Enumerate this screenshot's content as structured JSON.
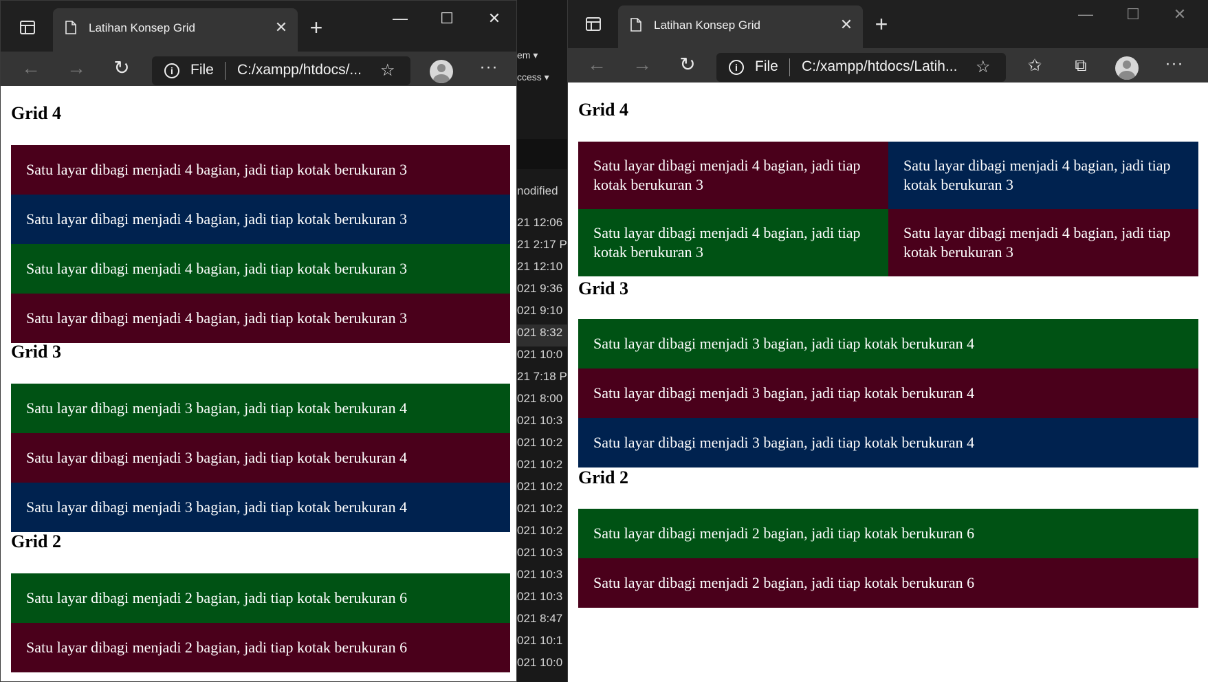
{
  "window_title": "Latihan Konsep Grid",
  "address": {
    "file_label": "File",
    "url_left": "C:/xampp/htdocs/...",
    "url_right": "C:/xampp/htdocs/Latih..."
  },
  "window_controls": {
    "minimize": "—",
    "maximize": "☐",
    "close": "✕"
  },
  "icons": {
    "back": "back-arrow-icon",
    "forward": "forward-arrow-icon",
    "refresh": "refresh-icon",
    "info": "info-icon",
    "favorite_add": "add-favorite-icon",
    "favorites": "favorites-icon",
    "collections": "collections-icon",
    "profile": "profile-avatar-icon",
    "menu": "more-icon"
  },
  "colors": {
    "maroon": "#4a001b",
    "navy": "#00224f",
    "green": "#005214"
  },
  "page": {
    "sections": [
      {
        "title": "Grid 4",
        "items": [
          {
            "text": "Satu layar dibagi menjadi 4 bagian, jadi tiap kotak berukuran 3",
            "color": "maroon"
          },
          {
            "text": "Satu layar dibagi menjadi 4 bagian, jadi tiap kotak berukuran 3",
            "color": "navy"
          },
          {
            "text": "Satu layar dibagi menjadi 4 bagian, jadi tiap kotak berukuran 3",
            "color": "green"
          },
          {
            "text": "Satu layar dibagi menjadi 4 bagian, jadi tiap kotak berukuran 3",
            "color": "maroon"
          }
        ]
      },
      {
        "title": "Grid 3",
        "items": [
          {
            "text": "Satu layar dibagi menjadi 3 bagian, jadi tiap kotak berukuran 4",
            "color": "green"
          },
          {
            "text": "Satu layar dibagi menjadi 3 bagian, jadi tiap kotak berukuran 4",
            "color": "maroon"
          },
          {
            "text": "Satu layar dibagi menjadi 3 bagian, jadi tiap kotak berukuran 4",
            "color": "navy"
          }
        ]
      },
      {
        "title": "Grid 2",
        "items": [
          {
            "text": "Satu layar dibagi menjadi 2 bagian, jadi tiap kotak berukuran 6",
            "color": "green"
          },
          {
            "text": "Satu layar dibagi menjadi 2 bagian, jadi tiap kotak berukuran 6",
            "color": "maroon"
          }
        ]
      }
    ]
  },
  "background_window": {
    "menu_items": [
      "em ▾",
      "ccess ▾"
    ],
    "column_header": "nodified",
    "rows": [
      "21 12:06",
      "21 2:17 P",
      "21 12:10",
      "021 9:36",
      "021 9:10",
      "021 8:32",
      "021 10:0",
      "21 7:18 P",
      "021 8:00",
      "021 10:3",
      "021 10:2",
      "021 10:2",
      "021 10:2",
      "021 10:2",
      "021 10:2",
      "021 10:3",
      "021 10:3",
      "021 10:3",
      "021 8:47",
      "021 10:1",
      "021 10:0"
    ]
  }
}
